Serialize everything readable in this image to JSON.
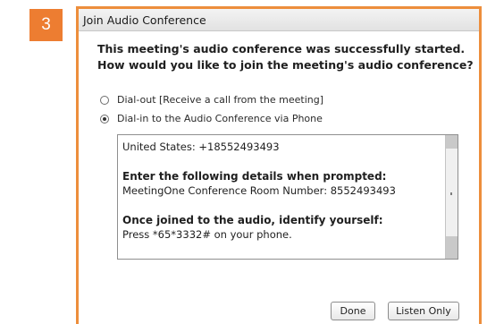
{
  "step": {
    "number": "3",
    "color": "#ed7d31"
  },
  "dialog": {
    "title": "Join Audio Conference",
    "border_color": "#ed8e3c",
    "intro_line1": "This meeting's audio conference was successfully started.",
    "intro_line2": "How would you like to join the meeting's audio conference?",
    "options": [
      {
        "label": "Dial-out [Receive a call from the meeting]",
        "selected": false
      },
      {
        "label": "Dial-in to the Audio Conference via Phone",
        "selected": true
      }
    ],
    "info": {
      "line1": "United States: +18552493493",
      "heading1": "Enter the following details when prompted:",
      "line2": "MeetingOne Conference Room Number: 8552493493",
      "heading2": "Once joined to the audio, identify yourself:",
      "line3": "Press *65*3332# on your phone."
    },
    "buttons": {
      "done": "Done",
      "listen_only": "Listen Only"
    }
  }
}
